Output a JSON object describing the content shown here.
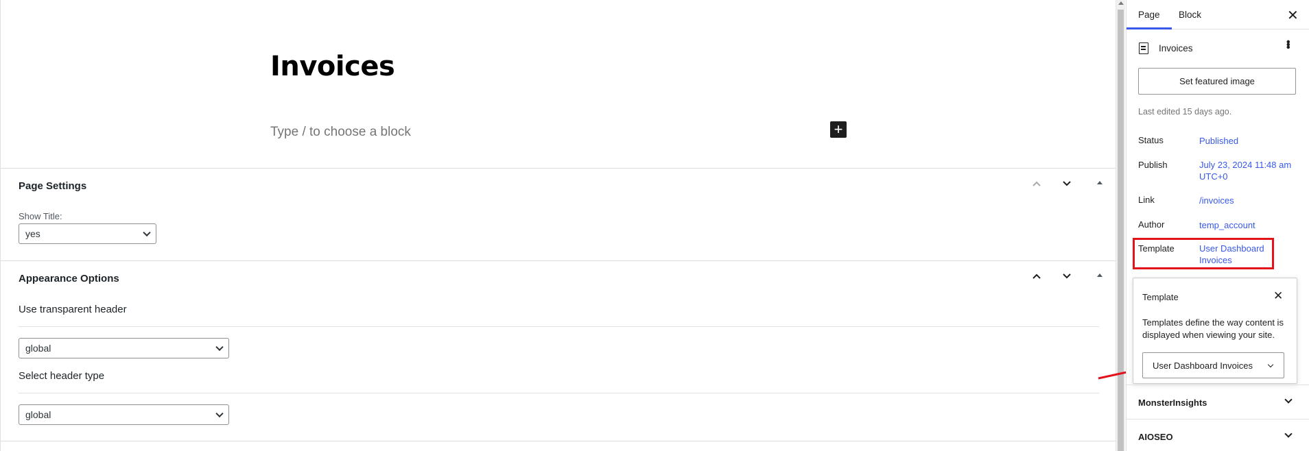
{
  "editor": {
    "title": "Invoices",
    "block_placeholder": "Type / to choose a block",
    "add_block_glyph": "+"
  },
  "page_settings": {
    "title": "Page Settings",
    "show_title_label": "Show Title:",
    "show_title_value": "yes"
  },
  "appearance_options": {
    "title": "Appearance Options",
    "transparent_header_label": "Use transparent header",
    "transparent_header_value": "global",
    "header_type_label": "Select header type",
    "header_type_value": "global"
  },
  "metabox_controls": {
    "up": "⌃",
    "down": "⌄",
    "toggle": "▲"
  },
  "sidebar": {
    "tabs": [
      {
        "label": "Page",
        "active": true
      },
      {
        "label": "Block",
        "active": false
      }
    ],
    "close_glyph": "✕",
    "doc_title": "Invoices",
    "more_glyph": "•••",
    "featured_image_button": "Set featured image",
    "last_edited": "Last edited 15 days ago.",
    "rows": {
      "status": {
        "label": "Status",
        "value": "Published"
      },
      "publish": {
        "label": "Publish",
        "value_line1": "July 23, 2024 11:48 am",
        "value_line2": "UTC+0"
      },
      "link": {
        "label": "Link",
        "value": "/invoices"
      },
      "author": {
        "label": "Author",
        "value": "temp_account"
      },
      "template": {
        "label": "Template",
        "value_line1": "User Dashboard",
        "value_line2": "Invoices"
      }
    },
    "template_popover": {
      "title": "Template",
      "close_glyph": "✕",
      "description": "Templates define the way content is displayed when viewing your site.",
      "selected": "User Dashboard Invoices"
    },
    "panels": [
      {
        "title": "MonsterInsights"
      },
      {
        "title": "AIOSEO"
      }
    ]
  },
  "colors": {
    "accent": "#3858e9",
    "annotation": "#e3131b"
  },
  "icons": {
    "document": "document-icon",
    "more": "more-vertical-icon",
    "close": "close-icon",
    "add": "plus-icon"
  }
}
